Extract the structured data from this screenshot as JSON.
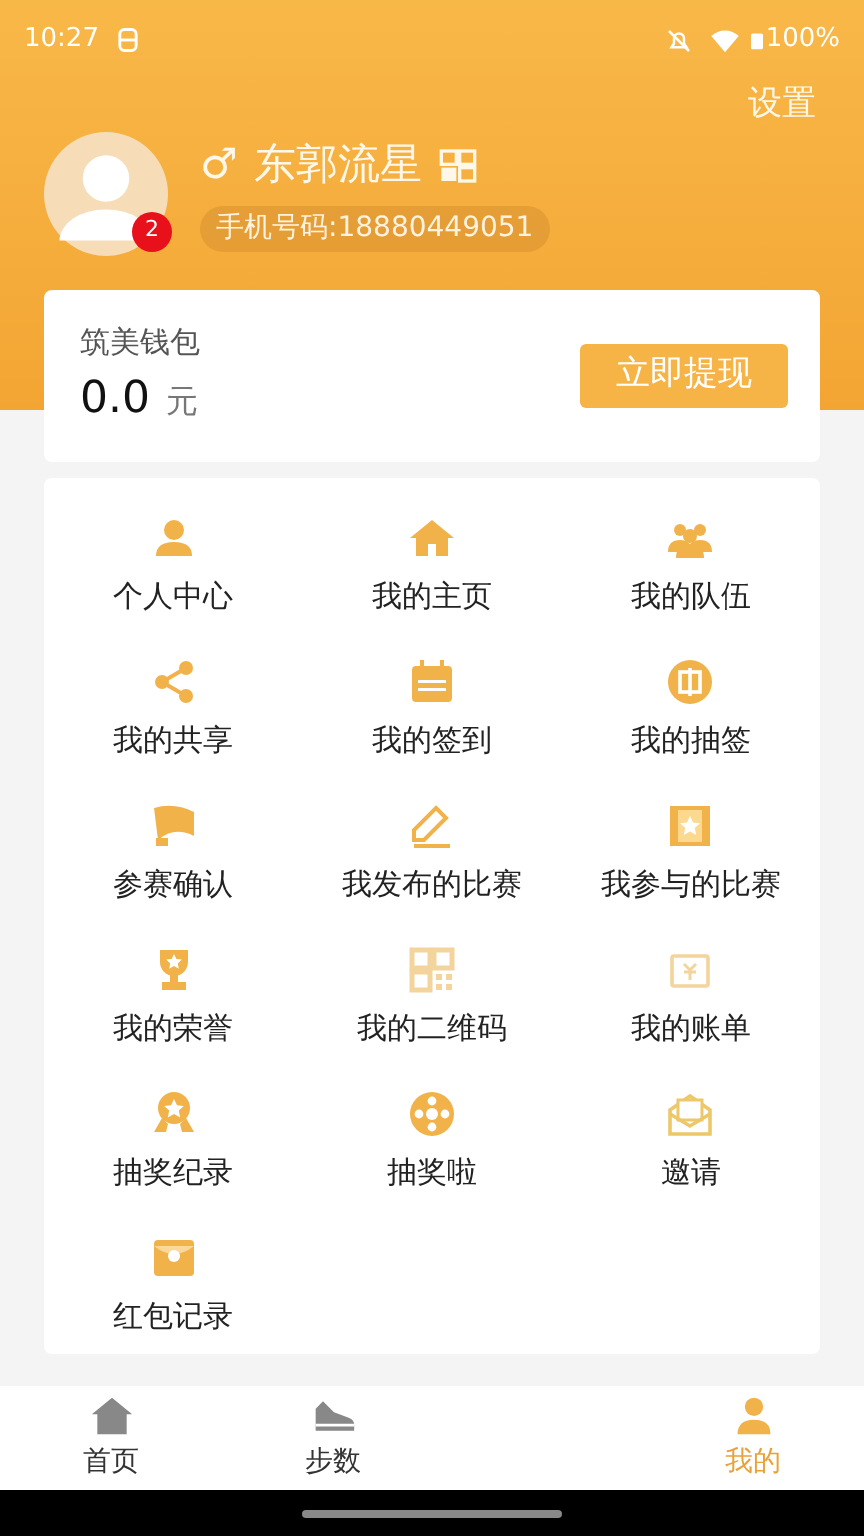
{
  "status_bar": {
    "time": "10:27",
    "battery": "100%"
  },
  "header": {
    "settings": "设置",
    "gender": "♂",
    "name": "东郭流星",
    "badge_count": "2",
    "phone": "手机号码:18880449051"
  },
  "wallet": {
    "title": "筑美钱包",
    "amount": "0.0",
    "unit": "元",
    "button": "立即提现"
  },
  "menu": [
    {
      "label": "个人中心"
    },
    {
      "label": "我的主页"
    },
    {
      "label": "我的队伍"
    },
    {
      "label": "我的共享"
    },
    {
      "label": "我的签到"
    },
    {
      "label": "我的抽签"
    },
    {
      "label": "参赛确认"
    },
    {
      "label": "我发布的比赛"
    },
    {
      "label": "我参与的比赛"
    },
    {
      "label": "我的荣誉"
    },
    {
      "label": "我的二维码"
    },
    {
      "label": "我的账单"
    },
    {
      "label": "抽奖纪录"
    },
    {
      "label": "抽奖啦"
    },
    {
      "label": "邀请"
    },
    {
      "label": "红包记录"
    }
  ],
  "tab_bar": [
    {
      "label": "首页",
      "selected": false,
      "kind": "home"
    },
    {
      "label": "步数",
      "selected": false,
      "kind": "steps"
    },
    {
      "label": "我的",
      "selected": true,
      "kind": "me"
    }
  ]
}
